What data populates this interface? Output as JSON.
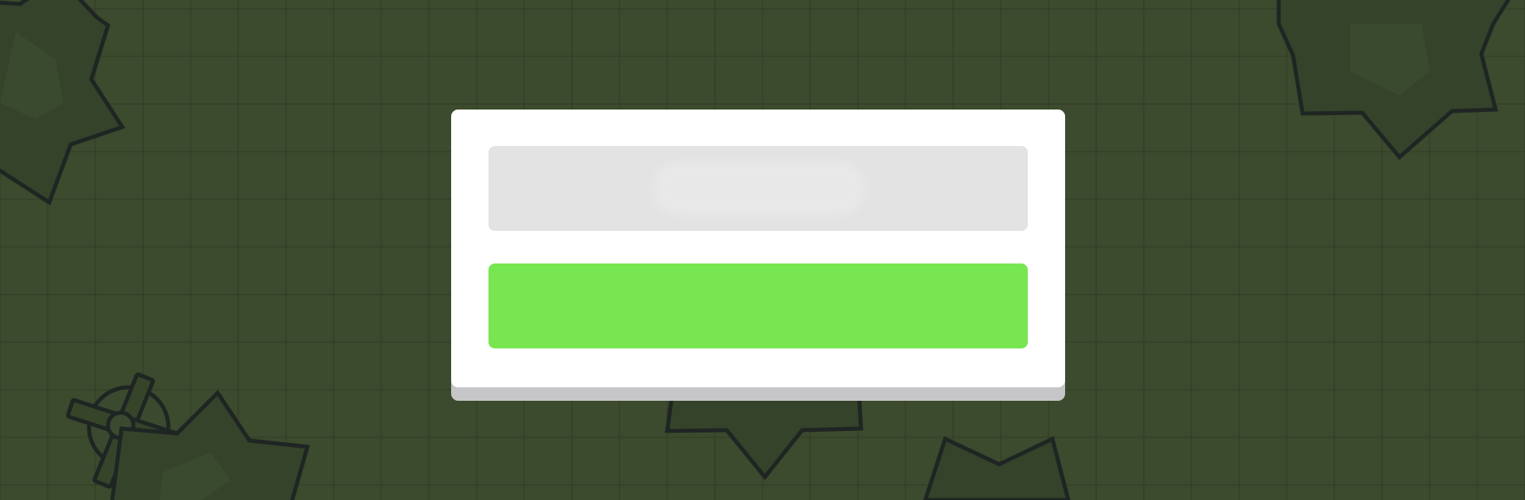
{
  "scene": {
    "background_color": "#3c4a2d",
    "shape_fill": "#34432a",
    "outline_color": "#1f2523"
  },
  "menu": {
    "name_input": {
      "value": "",
      "placeholder": ""
    },
    "play_button": {
      "label": "",
      "color": "#77e650"
    }
  }
}
